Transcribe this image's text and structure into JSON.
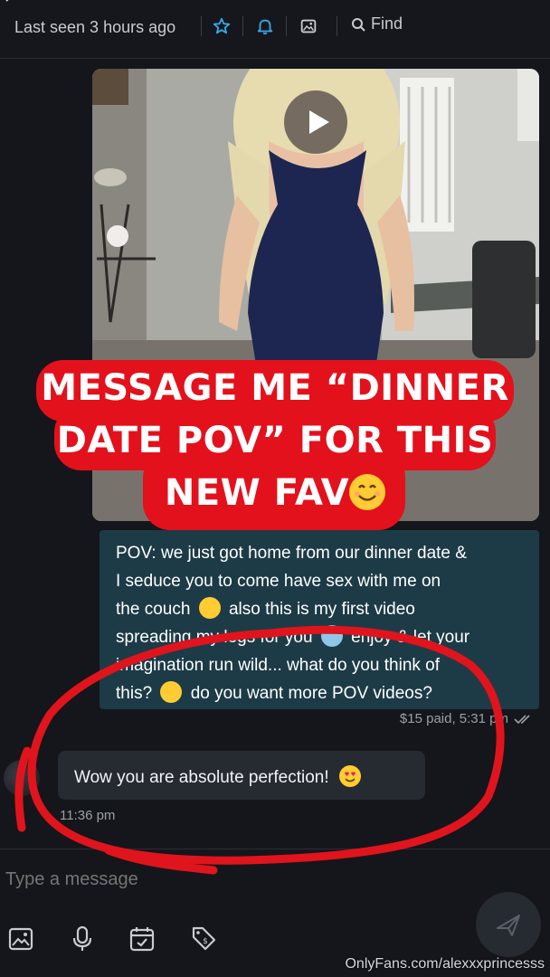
{
  "header": {
    "status": "Last seen 3 hours ago",
    "find_label": "Find",
    "icons": [
      "star-icon",
      "bell-icon",
      "image-icon",
      "search-icon"
    ],
    "accent": "#3aa8e6"
  },
  "media_message": {
    "has_play_button": true
  },
  "promo": {
    "line1": "MESSAGE ME “DINNER",
    "line2": "DATE POV” FOR THIS",
    "line3": "NEW FAV",
    "bg_color": "#e3111c"
  },
  "caption": {
    "line1": "POV: we just got home from our dinner date &",
    "line2": "I seduce you to come have sex with me on",
    "line3a": "the couch",
    "line3b": "also this is my first video",
    "line4a": "spreading my legs for you",
    "line4b": "enjoy & let your",
    "line5": "imagination run wild... what do you think of",
    "line6a": "this?",
    "line6b": "do you want more POV videos?",
    "meta": "$15 paid, 5:31 pm",
    "bg_color": "#1d3b47"
  },
  "incoming": {
    "text": "Wow you are absolute perfection!",
    "time": "11:36 pm"
  },
  "composer": {
    "placeholder": "Type a message",
    "icons": [
      "image-icon",
      "microphone-icon",
      "calendar-icon",
      "price-tag-icon",
      "send-icon"
    ]
  },
  "watermark": "OnlyFans.com/alexxxprincesss",
  "annotation_color": "#e0141c"
}
